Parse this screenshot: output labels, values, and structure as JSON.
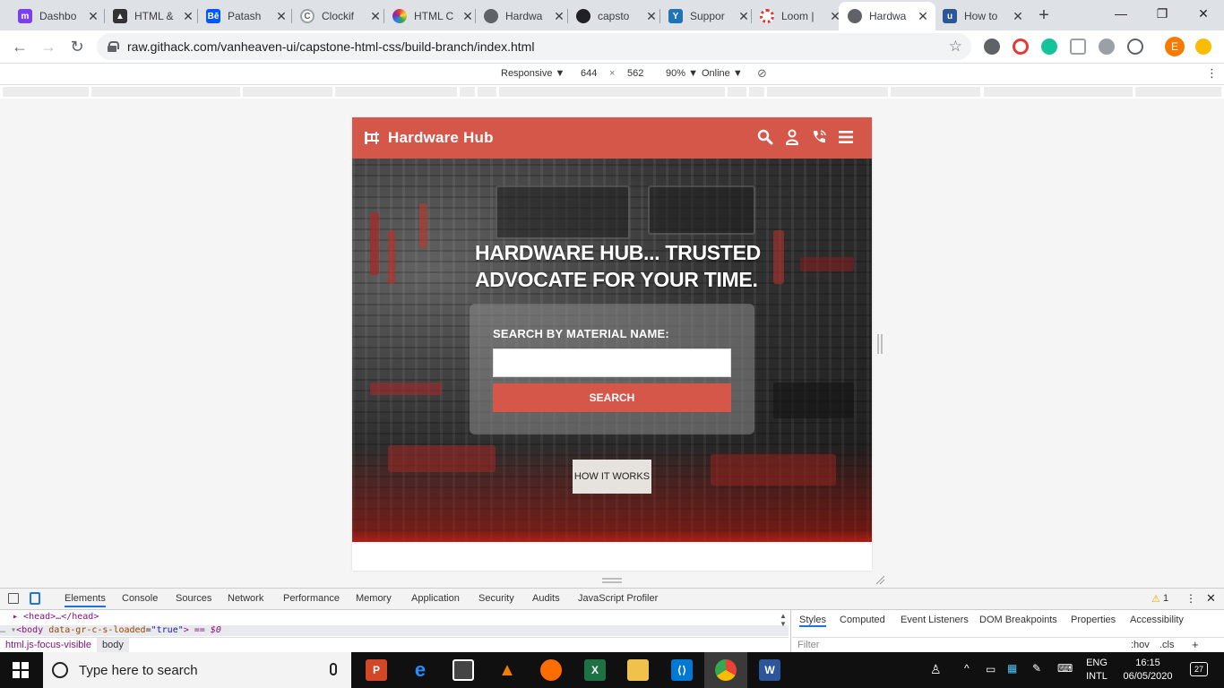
{
  "browser": {
    "tabs": [
      {
        "title": "Dashbo",
        "favicon": "dashboard-icon",
        "color": "#7b3ff2"
      },
      {
        "title": "HTML &",
        "favicon": "graduation-cap-icon",
        "color": "#333333"
      },
      {
        "title": "Patash",
        "favicon": "behance-icon",
        "color": "#0057ff"
      },
      {
        "title": "Clockif",
        "favicon": "clockify-icon",
        "color": "#9aa0a6"
      },
      {
        "title": "HTML C",
        "favicon": "colorwheel-icon",
        "color": "#e53935"
      },
      {
        "title": "Hardwa",
        "favicon": "globe-icon",
        "color": "#5f6368"
      },
      {
        "title": "capsto",
        "favicon": "github-icon",
        "color": "#202124"
      },
      {
        "title": "Suppor",
        "favicon": "zendesk-icon",
        "color": "#1f73b7"
      },
      {
        "title": "Loom |",
        "favicon": "loom-icon",
        "color": "#e53935"
      },
      {
        "title": "Hardwa",
        "favicon": "globe-icon",
        "color": "#5f6368",
        "active": true
      },
      {
        "title": "How to",
        "favicon": "udemy-icon",
        "color": "#2b5797"
      }
    ],
    "new_tab_label": "+",
    "url": "raw.githack.com/vanheaven-ui/capstone-html-css/build-branch/index.html",
    "profile_initial": "E"
  },
  "device_toolbar": {
    "mode": "Responsive ▼",
    "width": "644",
    "times": "×",
    "height": "562",
    "zoom": "90% ▼",
    "network": "Online ▼"
  },
  "site": {
    "brand": "Hardware Hub",
    "hero_title_line1": "HARDWARE  HUB... TRUSTED",
    "hero_title_line2": "ADVOCATE  FOR YOUR TIME.",
    "search_label": "SEARCH  BY  MATERIAL  NAME:",
    "search_value": "",
    "search_button": "SEARCH",
    "how_button": "HOW IT WORKS",
    "accent_color": "#d5574a"
  },
  "devtools": {
    "tabs": [
      "Elements",
      "Console",
      "Sources",
      "Network",
      "Performance",
      "Memory",
      "Application",
      "Security",
      "Audits",
      "JavaScript Profiler"
    ],
    "warning_count": "1",
    "dom_head": "<head>…</head>",
    "dom_body_open": "<body",
    "dom_body_attr_name": "data-gr-c-s-loaded",
    "dom_body_attr_value": "\"true\"",
    "dom_body_suffix": "> == $0",
    "side_tabs": [
      "Styles",
      "Computed",
      "Event Listeners",
      "DOM Breakpoints",
      "Properties",
      "Accessibility"
    ],
    "crumb1": "html.js-focus-visible",
    "crumb2": "body",
    "filter_placeholder": "Filter",
    "hov": ":hov",
    "cls": ".cls",
    "plus": "+"
  },
  "taskbar": {
    "search_placeholder": "Type here to search",
    "lang_line1": "ENG",
    "lang_line2": "INTL",
    "time": "16:15",
    "date": "06/05/2020",
    "notifications": "27"
  }
}
